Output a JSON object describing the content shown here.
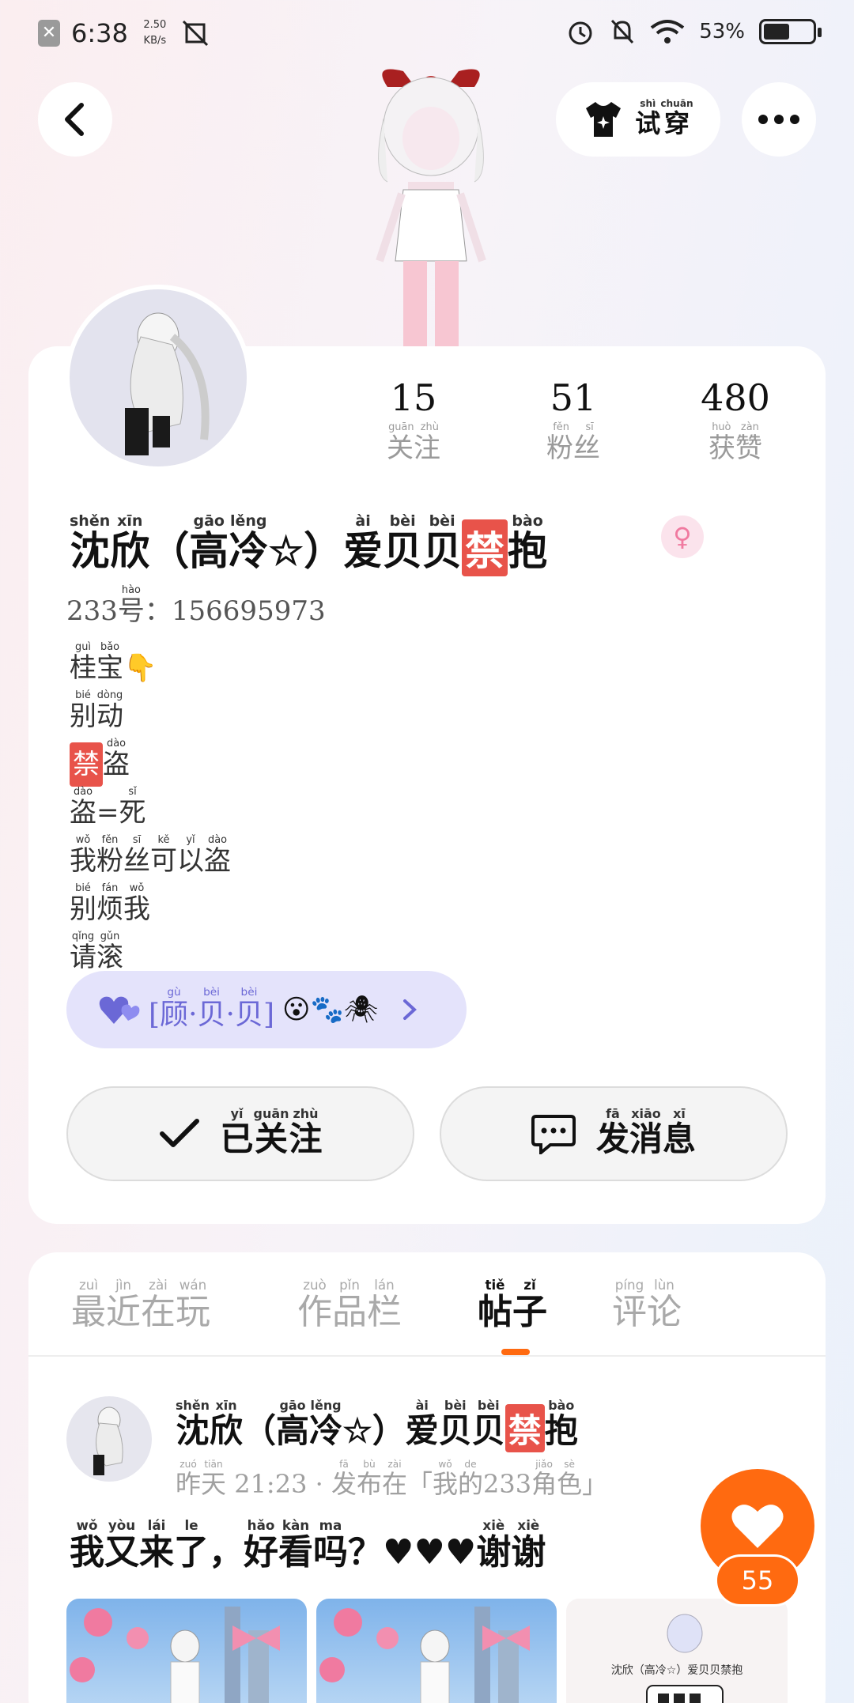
{
  "status_bar": {
    "time": "6:38",
    "speed_value": "2.50",
    "speed_unit": "KB/s",
    "battery": "53%",
    "battery_level": 0.53
  },
  "nav": {
    "back_icon": "chevron-left-icon",
    "try_on": {
      "ruby": "shì chuān",
      "label": "试穿"
    },
    "more_icon": "more-dots-icon"
  },
  "stats": [
    {
      "value": "15",
      "ruby": "guān zhù",
      "label": "关注"
    },
    {
      "value": "51",
      "ruby": "fěn sī",
      "label": "粉丝"
    },
    {
      "value": "480",
      "ruby": "huò zàn",
      "label": "获赞"
    }
  ],
  "profile": {
    "name_parts": [
      {
        "t": "沈",
        "r": "shěn"
      },
      {
        "t": "欣",
        "r": "xīn"
      },
      {
        "t": "（",
        "r": ""
      },
      {
        "t": "高",
        "r": "gāo"
      },
      {
        "t": "冷",
        "r": "lěng"
      },
      {
        "t": "☆",
        "r": ""
      },
      {
        "t": "）",
        "r": ""
      },
      {
        "t": "爱",
        "r": "ài"
      },
      {
        "t": "贝",
        "r": "bèi"
      },
      {
        "t": "贝",
        "r": "bèi"
      },
      {
        "t": "禁",
        "r": "",
        "ban": true
      },
      {
        "t": "抱",
        "r": "bào"
      }
    ],
    "gender_icon": "female-icon",
    "uid_prefix": "233",
    "uid_prefix_char": "号",
    "uid_prefix_ruby": "hào",
    "uid_sep": "：",
    "uid": "156695973",
    "bio_lines": [
      [
        {
          "t": "桂",
          "r": "guì"
        },
        {
          "t": "宝",
          "r": "bǎo"
        },
        {
          "t": "👇",
          "r": ""
        }
      ],
      [
        {
          "t": "别",
          "r": "bié"
        },
        {
          "t": "动",
          "r": "dòng"
        }
      ],
      [
        {
          "t": "禁",
          "r": "",
          "ban": true
        },
        {
          "t": "盗",
          "r": "dào"
        }
      ],
      [
        {
          "t": "盗",
          "r": "dào"
        },
        {
          "t": "=",
          "r": ""
        },
        {
          "t": "死",
          "r": "sǐ"
        }
      ],
      [
        {
          "t": "我",
          "r": "wǒ"
        },
        {
          "t": "粉",
          "r": "fěn"
        },
        {
          "t": "丝",
          "r": "sī"
        },
        {
          "t": "可",
          "r": "kě"
        },
        {
          "t": "以",
          "r": "yǐ"
        },
        {
          "t": "盗",
          "r": "dào"
        }
      ],
      [
        {
          "t": "别",
          "r": "bié"
        },
        {
          "t": "烦",
          "r": "fán"
        },
        {
          "t": "我",
          "r": "wǒ"
        }
      ],
      [
        {
          "t": "请",
          "r": "qǐng"
        },
        {
          "t": "滚",
          "r": "gǔn"
        }
      ]
    ]
  },
  "club": {
    "icon": "heart-pair-icon",
    "parts": [
      {
        "t": "[",
        "r": ""
      },
      {
        "t": "顾",
        "r": "gù"
      },
      {
        "t": "·",
        "r": ""
      },
      {
        "t": "贝",
        "r": "bèi"
      },
      {
        "t": "·",
        "r": ""
      },
      {
        "t": "贝",
        "r": "bèi"
      },
      {
        "t": "]",
        "r": ""
      }
    ],
    "emojis": "😮🐾🕷",
    "chevron_icon": "chevron-right-icon"
  },
  "actions": {
    "follow": {
      "icon": "check-icon",
      "ruby": [
        "yǐ",
        "guān",
        "zhù"
      ],
      "label": [
        "已",
        "关",
        "注"
      ]
    },
    "message": {
      "icon": "chat-bubble-icon",
      "ruby": [
        "fā",
        "xiāo",
        "xī"
      ],
      "label": [
        "发",
        "消",
        "息"
      ]
    }
  },
  "tabs": [
    {
      "chars": [
        "最",
        "近",
        "在",
        "玩"
      ],
      "ruby": [
        "zuì",
        "jìn",
        "zài",
        "wán"
      ],
      "active": false
    },
    {
      "chars": [
        "作",
        "品",
        "栏"
      ],
      "ruby": [
        "zuò",
        "pǐn",
        "lán"
      ],
      "active": false
    },
    {
      "chars": [
        "帖",
        "子"
      ],
      "ruby": [
        "tiě",
        "zǐ"
      ],
      "active": true
    },
    {
      "chars": [
        "评",
        "论"
      ],
      "ruby": [
        "píng",
        "lùn"
      ],
      "active": false
    }
  ],
  "post": {
    "meta_parts": [
      {
        "t": "昨",
        "r": "zuó"
      },
      {
        "t": "天",
        "r": "tiān"
      },
      {
        "t": " 21:23 · ",
        "r": ""
      },
      {
        "t": "发",
        "r": "fā"
      },
      {
        "t": "布",
        "r": "bù"
      },
      {
        "t": "在",
        "r": "zài"
      },
      {
        "t": "「",
        "r": ""
      },
      {
        "t": "我",
        "r": "wǒ"
      },
      {
        "t": "的",
        "r": "de"
      },
      {
        "t": "233",
        "r": ""
      },
      {
        "t": "角",
        "r": "jiǎo"
      },
      {
        "t": "色",
        "r": "sè"
      },
      {
        "t": "」",
        "r": ""
      }
    ],
    "text_parts": [
      {
        "t": "我",
        "r": "wǒ"
      },
      {
        "t": "又",
        "r": "yòu"
      },
      {
        "t": "来",
        "r": "lái"
      },
      {
        "t": "了",
        "r": "le"
      },
      {
        "t": "，",
        "r": ""
      },
      {
        "t": "好",
        "r": "hǎo"
      },
      {
        "t": "看",
        "r": "kàn"
      },
      {
        "t": "吗",
        "r": "ma"
      },
      {
        "t": "？",
        "r": ""
      },
      {
        "t": "♥♥♥",
        "r": ""
      },
      {
        "t": "谢",
        "r": "xiè"
      },
      {
        "t": "谢",
        "r": "xiè"
      }
    ],
    "thumb3_caption": "沈欣（高冷☆）爱贝贝禁抱",
    "like_icon": "heart-icon",
    "likes": "55"
  },
  "colors": {
    "accent": "#ff6a10",
    "ban": "#e8534a",
    "club": "#6b68d6"
  }
}
